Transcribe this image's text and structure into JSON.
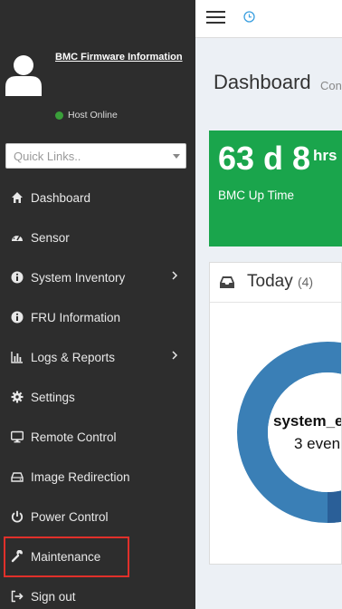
{
  "sidebar": {
    "firmware_link": "BMC Firmware Information",
    "host_status": "Host Online",
    "host_status_color": "#3a9f3a",
    "quick_links_placeholder": "Quick Links..",
    "items": [
      {
        "label": "Dashboard",
        "icon": "home-icon"
      },
      {
        "label": "Sensor",
        "icon": "gauge-icon"
      },
      {
        "label": "System Inventory",
        "icon": "info-icon",
        "submenu": true
      },
      {
        "label": "FRU Information",
        "icon": "info-icon"
      },
      {
        "label": "Logs & Reports",
        "icon": "bar-chart-icon",
        "submenu": true
      },
      {
        "label": "Settings",
        "icon": "gear-icon"
      },
      {
        "label": "Remote Control",
        "icon": "monitor-icon"
      },
      {
        "label": "Image Redirection",
        "icon": "drive-icon"
      },
      {
        "label": "Power Control",
        "icon": "power-icon"
      },
      {
        "label": "Maintenance",
        "icon": "wrench-icon",
        "highlighted": true
      },
      {
        "label": "Sign out",
        "icon": "signout-icon"
      }
    ]
  },
  "main": {
    "title": "Dashboard",
    "subtitle": "Con",
    "uptime": {
      "value": "63 d 8",
      "unit": "hrs",
      "label": "BMC Up Time",
      "color": "#1aa54c"
    },
    "today": {
      "title": "Today",
      "count": "(4)",
      "donut_label": "system_e",
      "donut_sub": "3 even"
    }
  },
  "colors": {
    "sidebar_bg": "#2d2d2d",
    "accent_blue": "#3a7fb6",
    "highlight_border": "#e0302a"
  }
}
